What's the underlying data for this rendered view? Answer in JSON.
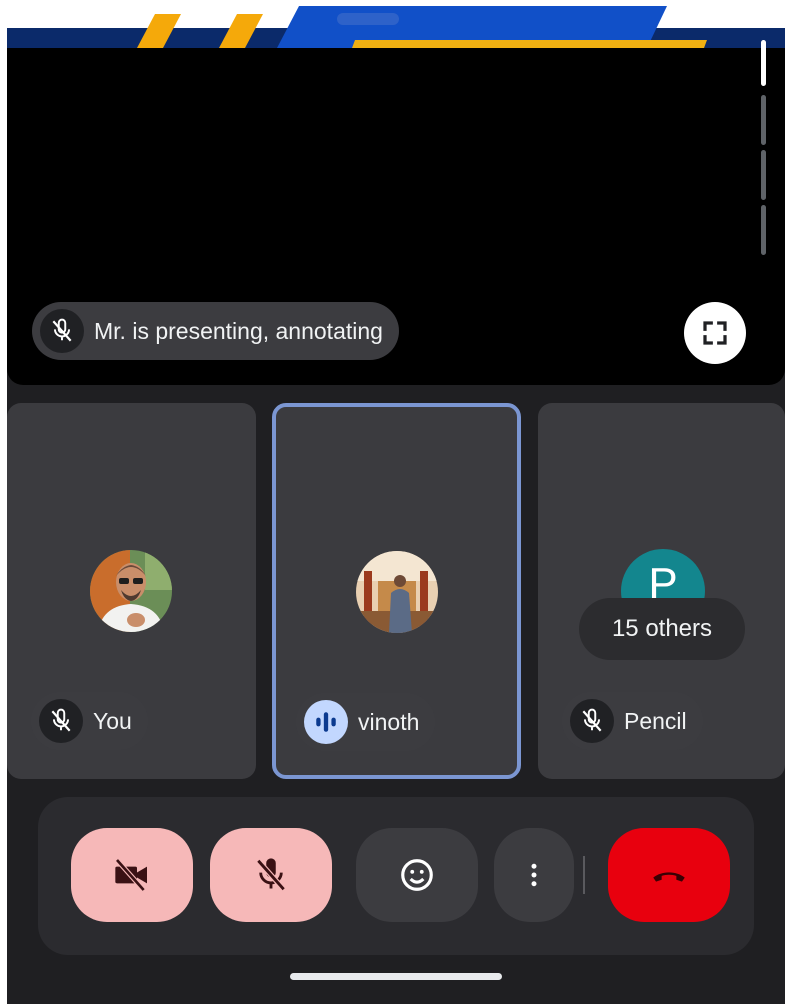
{
  "presentation": {
    "presenter_label": "Mr. is presenting, annotating",
    "presenter_mic_icon": "mic-off-icon",
    "fullscreen_icon": "fullscreen-icon"
  },
  "participants": [
    {
      "name": "You",
      "status_icon": "mic-off-icon",
      "avatar": "photo"
    },
    {
      "name": "vinoth",
      "status_icon": "speaking-audio-icon",
      "avatar": "photo",
      "active": true
    },
    {
      "name": "Pencil",
      "status_icon": "mic-off-icon",
      "avatar_letter": "P",
      "overflow_label": "15 others"
    }
  ],
  "controls": [
    {
      "id": "camera",
      "icon": "camera-off-icon"
    },
    {
      "id": "mic",
      "icon": "mic-off-icon"
    },
    {
      "id": "reactions",
      "icon": "emoji-icon"
    },
    {
      "id": "more",
      "icon": "more-vert-icon"
    },
    {
      "id": "leave",
      "icon": "call-end-icon"
    }
  ],
  "colors": {
    "muted_button": "#f6b8b8",
    "end_call": "#e8000e",
    "active_speaker_border": "#7b96d2",
    "speaking_badge": "#c2d7fe",
    "avatar_teal": "#13868e"
  }
}
